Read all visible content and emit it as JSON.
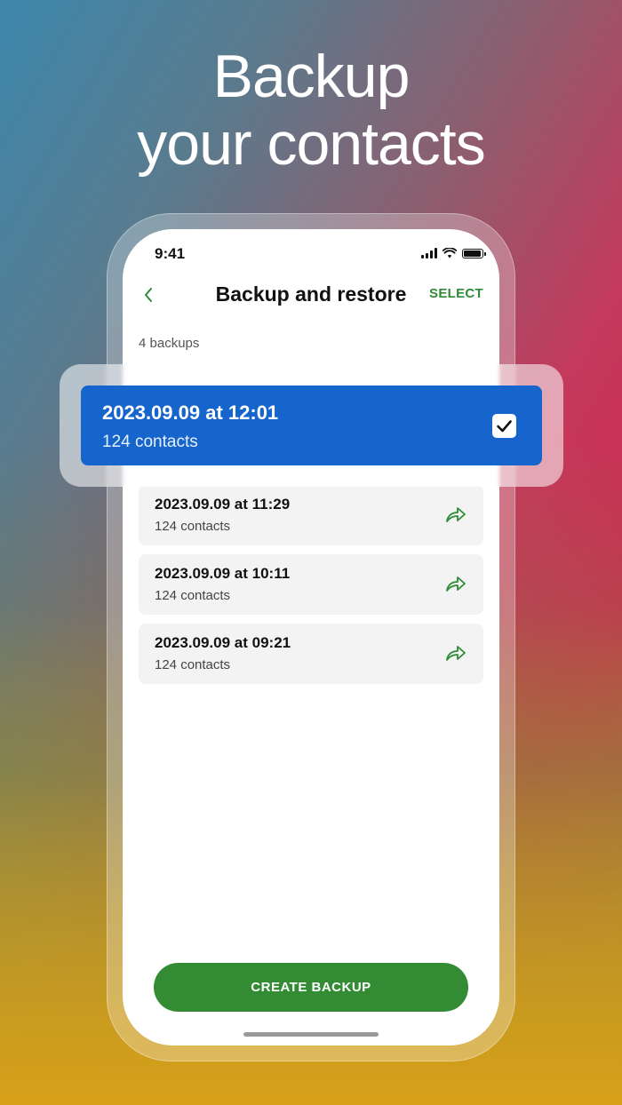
{
  "headline": {
    "line1": "Backup",
    "line2": "your contacts"
  },
  "status_bar": {
    "time": "9:41"
  },
  "nav": {
    "title": "Backup and restore",
    "select_label": "SELECT"
  },
  "backups_count": "4 backups",
  "selected_backup": {
    "title": "2023.09.09 at 12:01",
    "subtitle": "124 contacts",
    "checked": true
  },
  "backups": [
    {
      "title": "2023.09.09 at 11:29",
      "subtitle": "124 contacts"
    },
    {
      "title": "2023.09.09 at 10:11",
      "subtitle": "124 contacts"
    },
    {
      "title": "2023.09.09 at 09:21",
      "subtitle": "124 contacts"
    }
  ],
  "create_button": {
    "label": "CREATE BACKUP"
  },
  "colors": {
    "accent_green": "#338b34",
    "selected_blue": "#1565cc"
  },
  "icons": {
    "back": "chevron-left-icon",
    "share": "share-arrow-icon",
    "check": "checkbox-checked-icon"
  }
}
